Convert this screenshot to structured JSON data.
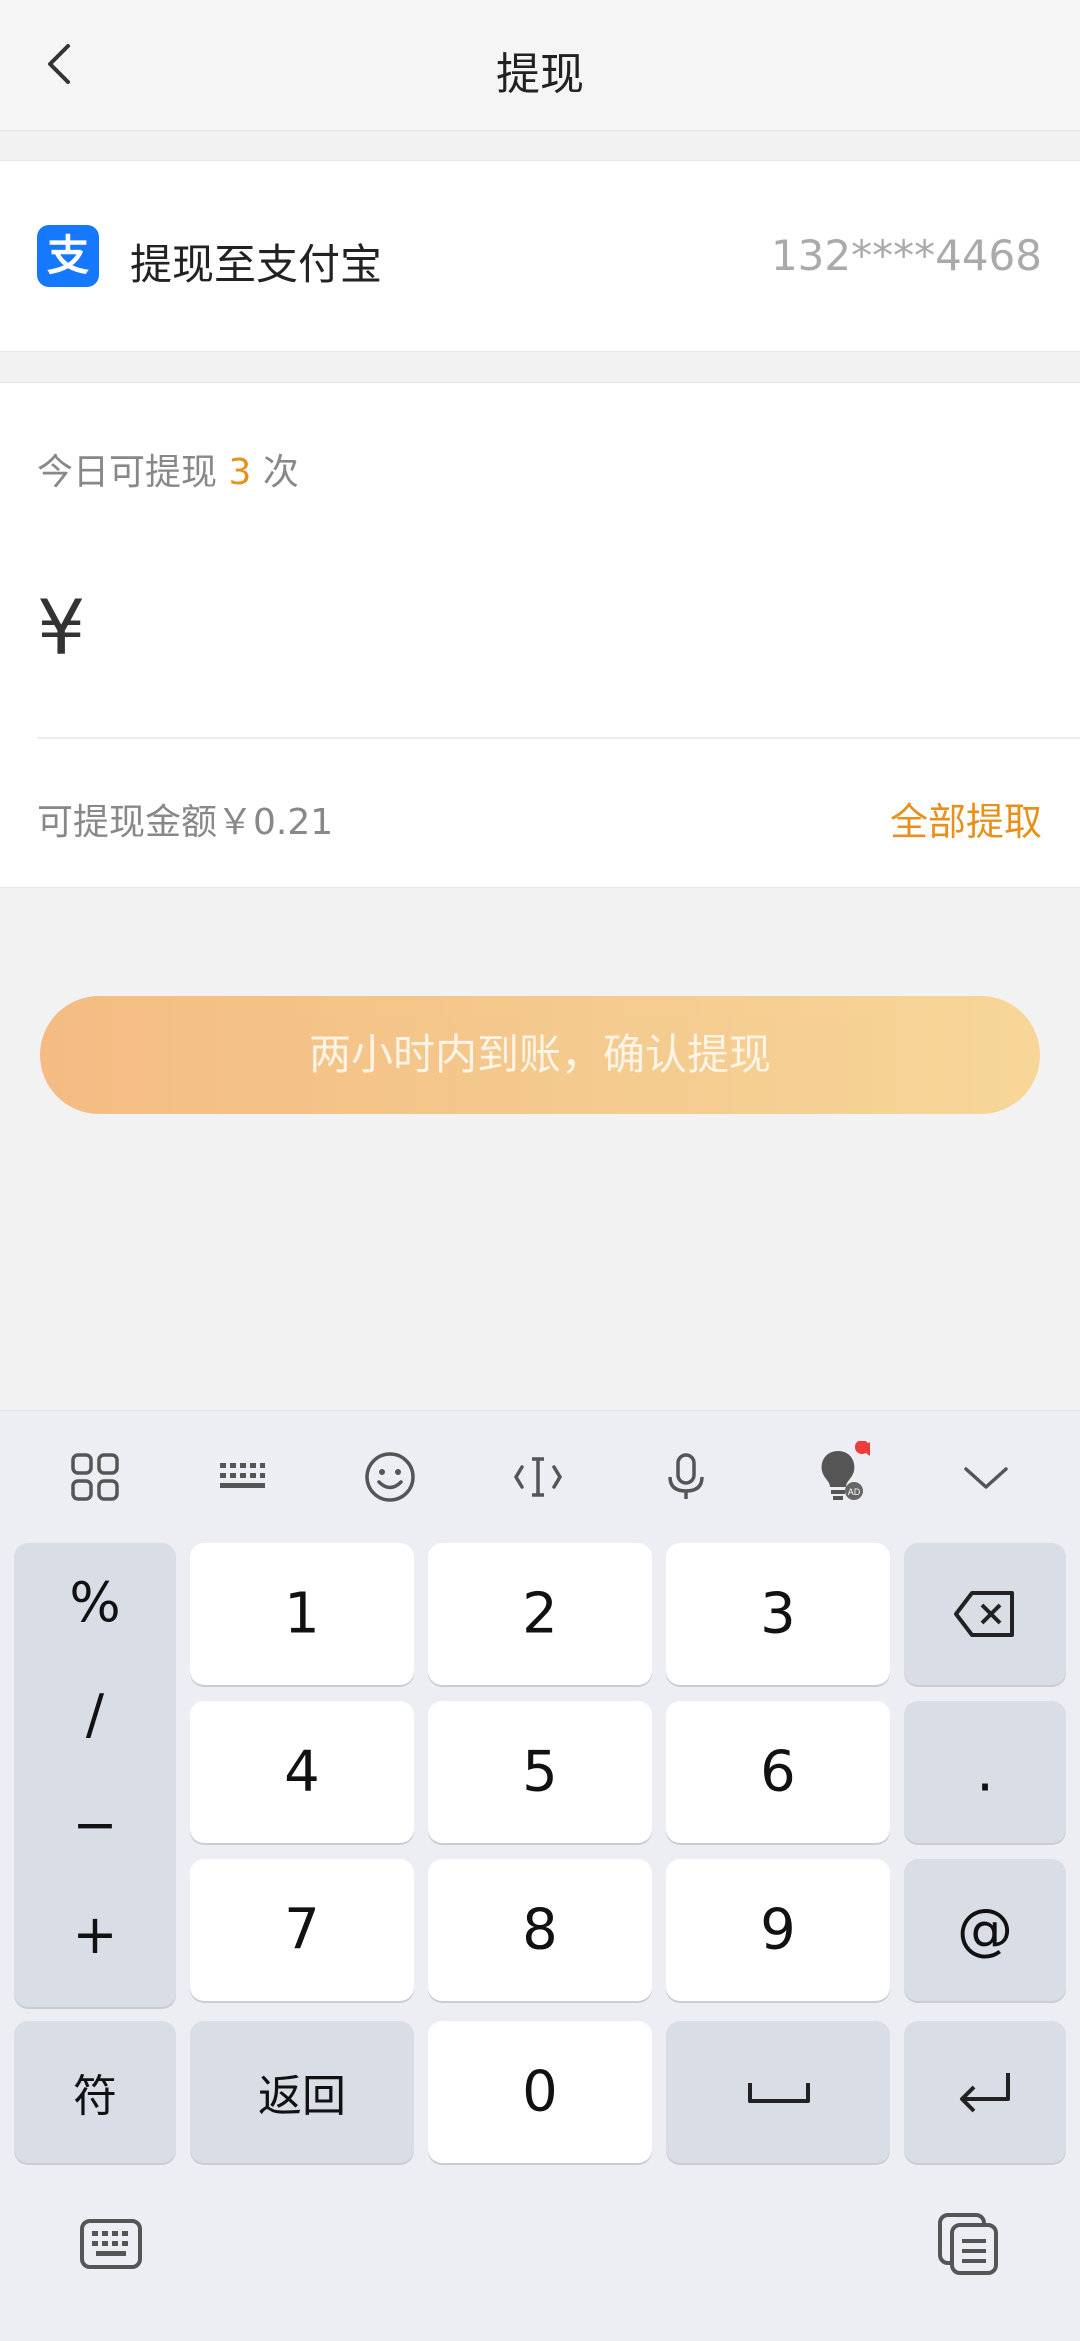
{
  "header": {
    "title": "提现",
    "back_icon": "chevron-left-icon"
  },
  "account_card": {
    "logo_text": "支",
    "logo_color": "#1677ff",
    "label": "提现至支付宝",
    "account": "132****4468"
  },
  "amount_card": {
    "times_prefix": "今日可提现",
    "times_count": "3",
    "times_suffix": "次",
    "currency": "¥",
    "available": "可提现金额￥0.21",
    "withdraw_all": "全部提取",
    "accent_color": "#e8901c"
  },
  "confirm_button": {
    "label": "两小时内到账，确认提现"
  },
  "keyboard": {
    "toolbar_icons": [
      "apps-grid-icon",
      "keyboard-layout-icon",
      "emoji-icon",
      "cursor-icon",
      "microphone-icon",
      "lightbulb-ad-icon",
      "chevron-down-icon"
    ],
    "symbols": [
      "%",
      "/",
      "−",
      "+"
    ],
    "digits": [
      "1",
      "2",
      "3",
      "4",
      "5",
      "6",
      "7",
      "8",
      "9",
      "0"
    ],
    "dot": ".",
    "at": "@",
    "fu": "符",
    "back": "返回"
  }
}
